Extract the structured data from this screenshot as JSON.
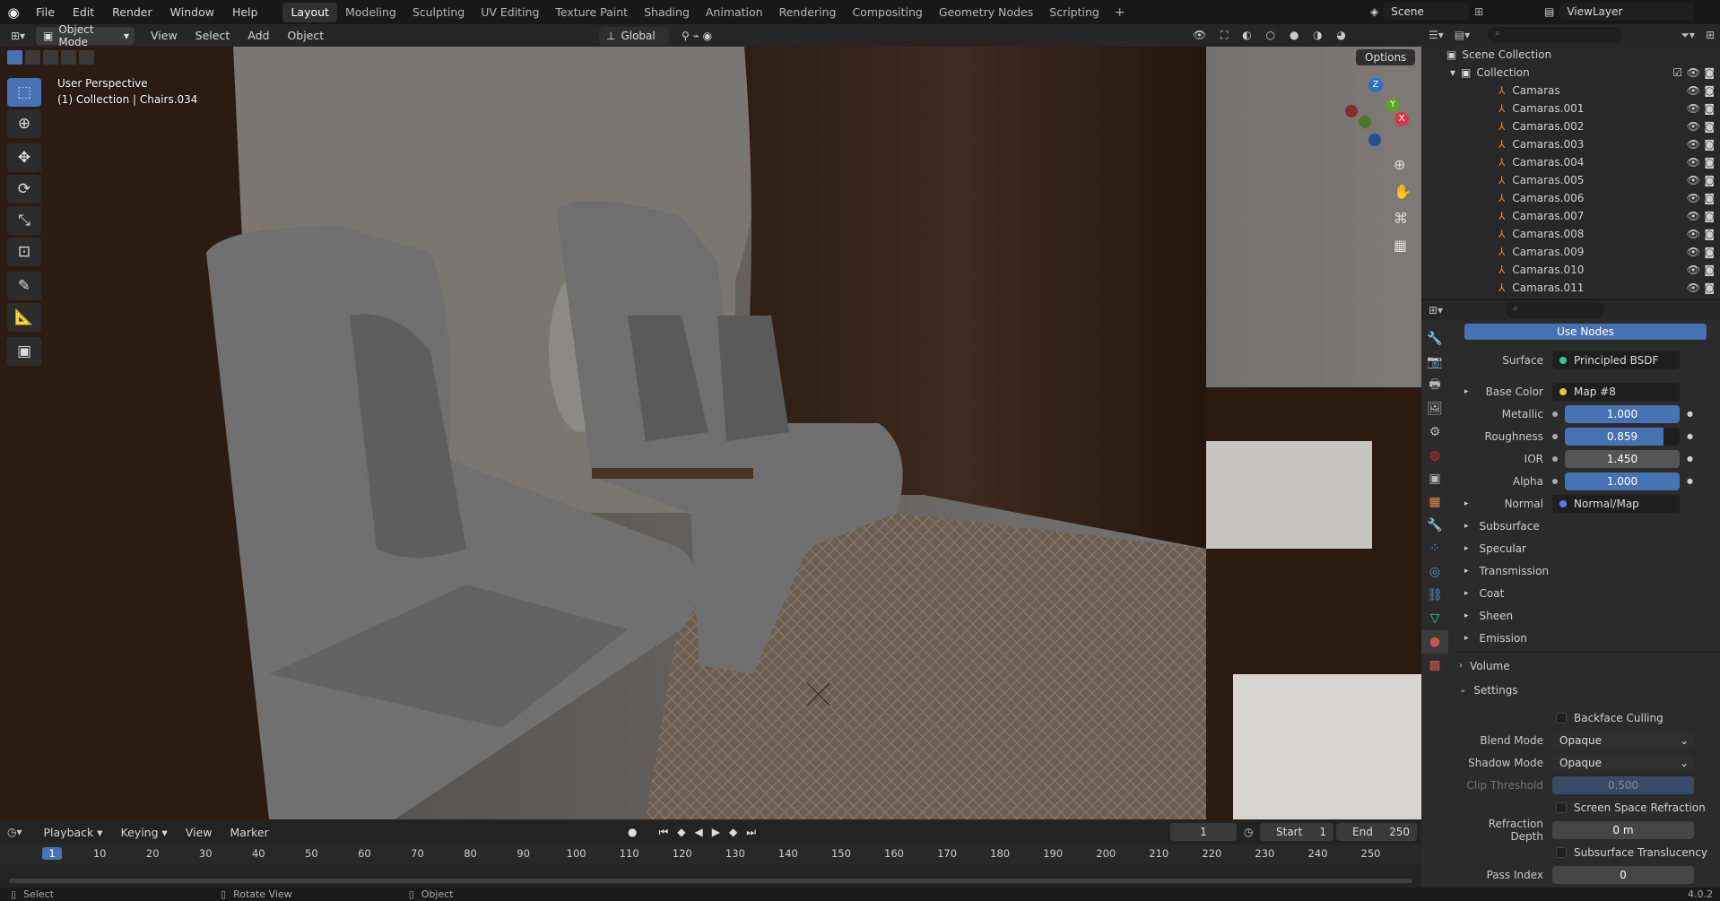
{
  "topbar": {
    "menus": [
      "File",
      "Edit",
      "Render",
      "Window",
      "Help"
    ],
    "workspaces": [
      "Layout",
      "Modeling",
      "Sculpting",
      "UV Editing",
      "Texture Paint",
      "Shading",
      "Animation",
      "Rendering",
      "Compositing",
      "Geometry Nodes",
      "Scripting"
    ],
    "active_workspace": "Layout",
    "scene": "Scene",
    "view_layer": "ViewLayer"
  },
  "viewport_header": {
    "mode": "Object Mode",
    "menus": [
      "View",
      "Select",
      "Add",
      "Object"
    ],
    "transform": "Global",
    "options": "Options"
  },
  "viewport": {
    "perspective": "User Perspective",
    "collection_info": "(1) Collection | Chairs.034",
    "gizmo_axes": {
      "x": "X",
      "y": "Y",
      "z": "Z"
    }
  },
  "outliner": {
    "root": "Scene Collection",
    "collection": "Collection",
    "items": [
      "Camaras",
      "Camaras.001",
      "Camaras.002",
      "Camaras.003",
      "Camaras.004",
      "Camaras.005",
      "Camaras.006",
      "Camaras.007",
      "Camaras.008",
      "Camaras.009",
      "Camaras.010",
      "Camaras.011"
    ]
  },
  "properties": {
    "use_nodes": "Use Nodes",
    "surface_label": "Surface",
    "surface_value": "Principled BSDF",
    "base_color_label": "Base Color",
    "base_color_value": "Map #8",
    "metallic_label": "Metallic",
    "metallic_value": "1.000",
    "metallic_fraction": 1.0,
    "roughness_label": "Roughness",
    "roughness_value": "0.859",
    "roughness_fraction": 0.859,
    "ior_label": "IOR",
    "ior_value": "1.450",
    "alpha_label": "Alpha",
    "alpha_value": "1.000",
    "alpha_fraction": 1.0,
    "normal_label": "Normal",
    "normal_value": "Normal/Map",
    "subsections": [
      "Subsurface",
      "Specular",
      "Transmission",
      "Coat",
      "Sheen",
      "Emission"
    ],
    "volume": "Volume",
    "settings": "Settings",
    "backface_culling": "Backface Culling",
    "blend_mode_label": "Blend Mode",
    "blend_mode_value": "Opaque",
    "shadow_mode_label": "Shadow Mode",
    "shadow_mode_value": "Opaque",
    "clip_threshold_label": "Clip Threshold",
    "clip_threshold_value": "0.500",
    "screen_space_refraction": "Screen Space Refraction",
    "refraction_depth_label": "Refraction Depth",
    "refraction_depth_value": "0 m",
    "subsurface_translucency": "Subsurface Translucency",
    "pass_index_label": "Pass Index",
    "pass_index_value": "0"
  },
  "timeline": {
    "menus": [
      "Playback",
      "Keying",
      "View",
      "Marker"
    ],
    "current_frame": "1",
    "start_label": "Start",
    "start_value": "1",
    "end_label": "End",
    "end_value": "250",
    "ruler": [
      "1",
      "10",
      "20",
      "30",
      "40",
      "50",
      "60",
      "70",
      "80",
      "90",
      "100",
      "110",
      "120",
      "130",
      "140",
      "150",
      "160",
      "170",
      "180",
      "190",
      "200",
      "210",
      "220",
      "230",
      "240",
      "250"
    ]
  },
  "statusbar": {
    "select": "Select",
    "rotate": "Rotate View",
    "object": "Object",
    "version": "4.0.2"
  },
  "colors": {
    "accent": "#4772b3",
    "header": "#181818",
    "panel": "#2b2b2b"
  }
}
